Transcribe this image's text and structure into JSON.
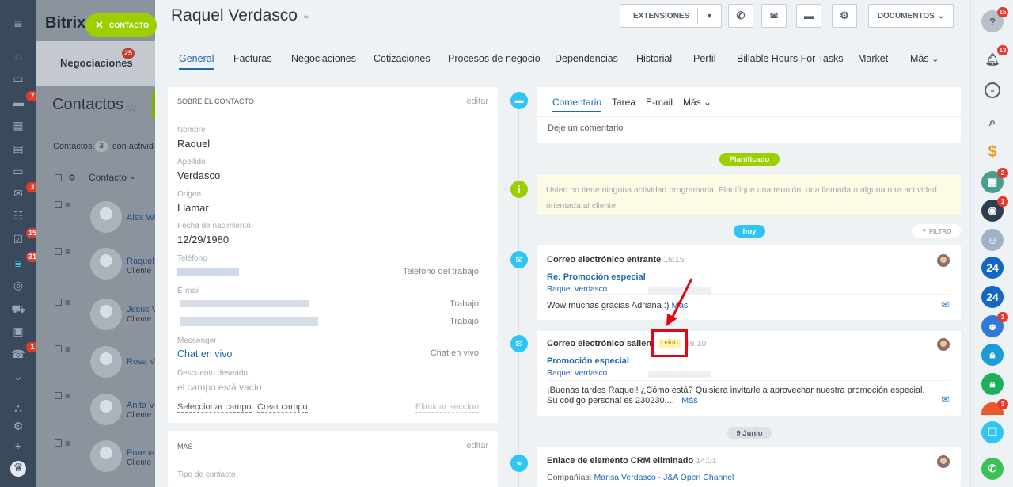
{
  "bg": {
    "brand": "Bitrix",
    "deals": "Negociaciones",
    "deals_count": "25",
    "page_title": "Contactos",
    "filter_prefix": "Contactos:",
    "filter_count": "3",
    "filter_suffix": "con activid",
    "col_contact": "Contacto",
    "rows": [
      {
        "name": "Alex Wi",
        "sub": ""
      },
      {
        "name": "Raquel",
        "sub": "Cliente"
      },
      {
        "name": "Jesús V",
        "sub": "Cliente"
      },
      {
        "name": "Rosa V",
        "sub": ""
      },
      {
        "name": "Anita V",
        "sub": "Cliente"
      },
      {
        "name": "Prueba",
        "sub": "Cliente"
      }
    ]
  },
  "leftnav_badges": {
    "b1": "7",
    "b2": "3",
    "b3": "15",
    "b4": "31",
    "b5": "1"
  },
  "close_chip": "CONTACTO",
  "contact": {
    "first_name": "Raquel",
    "last_name": "Verdasco"
  },
  "toolbar": {
    "extensions": "EXTENSIONES",
    "documents": "DOCUMENTOS"
  },
  "tabs": [
    "General",
    "Facturas",
    "Negociaciones",
    "Cotizaciones",
    "Procesos de negocio",
    "Dependencias",
    "Historial",
    "Perfil",
    "Billable Hours For Tasks",
    "Market",
    "Más"
  ],
  "about": {
    "header": "SOBRE EL CONTACTO",
    "edit": "editar",
    "f_name_label": "Nombre",
    "f_name": "Raquel",
    "f_last_label": "Apellido",
    "f_last": "Verdasco",
    "f_origin_label": "Origen",
    "f_origin": "Llamar",
    "f_birth_label": "Fecha de nacimiento",
    "f_birth": "12/29/1980",
    "f_phone_label": "Teléfono",
    "f_phone_type": "Teléfono del trabajo",
    "f_email_label": "E-mail",
    "f_email_type1": "Trabajo",
    "f_email_type2": "Trabajo",
    "f_msg_label": "Messenger",
    "f_msg": "Chat en vivo",
    "f_msg_type": "Chat en vivo",
    "f_disc_label": "Descuento deseado",
    "f_disc": "el campo está vacío",
    "select_field": "Seleccionar campo",
    "create_field": "Crear campo",
    "delete_section": "Eliminar sección"
  },
  "more": {
    "header": "MÁS",
    "edit": "editar",
    "contact_type_label": "Tipo de contacto"
  },
  "composer": {
    "tabs": [
      "Comentario",
      "Tarea",
      "E-mail",
      "Más"
    ],
    "placeholder": "Deje un comentario"
  },
  "timeline": {
    "planned_pill": "Planificado",
    "planned_text": "Usted no tiene ninguna actividad programada. Planifique una reunión, una llamada o alguna otra actividad orientada al cliente.",
    "today_pill": "hoy",
    "filter": "FILTRO",
    "e1": {
      "title": "Correo electrónico entrante",
      "time": "16:15",
      "subject": "Re: Promoción especial",
      "from": "Raquel Verdasco",
      "body": "Wow muchas gracias Adriana :)",
      "more": "Más"
    },
    "e2": {
      "title": "Correo electrónico saliente",
      "badge": "LEÍDO",
      "time": "16:10",
      "subject": "Promoción especial",
      "from": "Raquel Verdasco",
      "body": "¡Buenas tardes Raquel! ¿Cómo está? Quisiera invitarle a aprovechar nuestra promoción especial. Su código personal es 230230,...",
      "more": "Más"
    },
    "june_pill": "9 Junio",
    "e3": {
      "title": "Enlace de elemento CRM eliminado",
      "time": "14:01",
      "company_label": "Compañías:",
      "company": "Marisa Verdasco - J&A Open Channel"
    }
  },
  "rightbar": {
    "b_help": "15",
    "b_bell": "13",
    "b_calc": "2",
    "b_grp": "1",
    "b_b24a": "24",
    "b_b24b": "24",
    "b_users": "1",
    "b_last": "3"
  },
  "colors": {
    "accent": "#2067b0",
    "green": "#9dcf00",
    "cyan": "#2fc6f6",
    "highlight": "#e30613"
  }
}
